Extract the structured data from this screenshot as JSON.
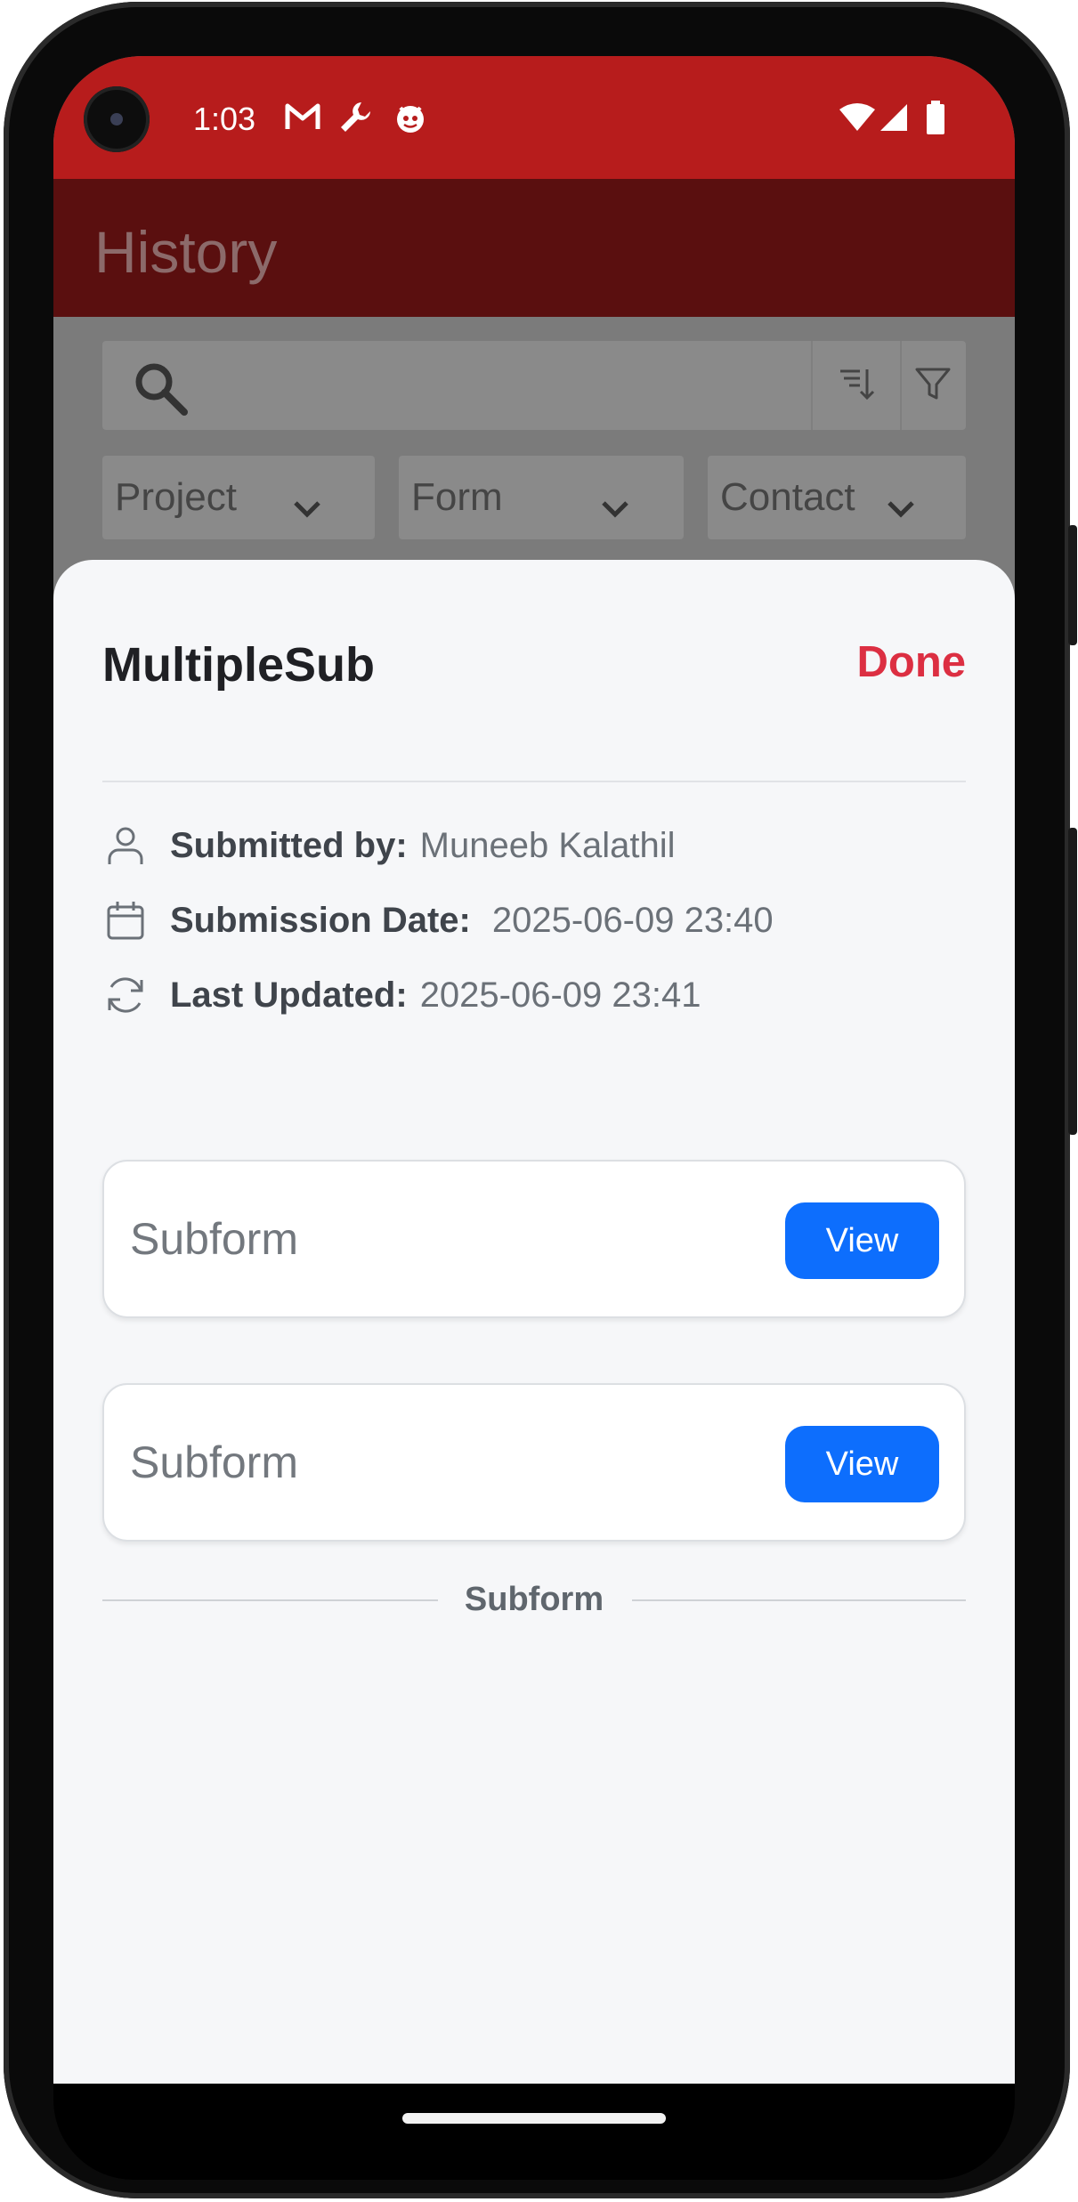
{
  "status_bar": {
    "time": "1:03",
    "left_icons": [
      "gmail-icon",
      "wrench-icon",
      "app-notification-icon"
    ],
    "right_icons": [
      "wifi-icon",
      "signal-icon",
      "battery-icon"
    ],
    "color": "#b71c1c"
  },
  "app_bar": {
    "title": "History"
  },
  "search": {
    "value": "",
    "icons": [
      "search-icon",
      "sort-icon",
      "filter-icon"
    ]
  },
  "filters": [
    {
      "label": "Project"
    },
    {
      "label": "Form"
    },
    {
      "label": "Contact"
    }
  ],
  "sheet": {
    "title": "MultipleSub",
    "done_label": "Done",
    "done_color": "#dc2f42",
    "meta": [
      {
        "icon": "person-icon",
        "label": "Submitted by:",
        "value": "Muneeb Kalathil"
      },
      {
        "icon": "calendar-icon",
        "label": "Submission Date:",
        "value": "2025-06-09 23:40"
      },
      {
        "icon": "refresh-icon",
        "label": "Last Updated:",
        "value": "2025-06-09 23:41"
      }
    ],
    "section_label": "Subform",
    "cards": [
      {
        "title": "Subform",
        "button": "View"
      },
      {
        "title": "Subform",
        "button": "View"
      }
    ],
    "button_color": "#0d6efd"
  }
}
